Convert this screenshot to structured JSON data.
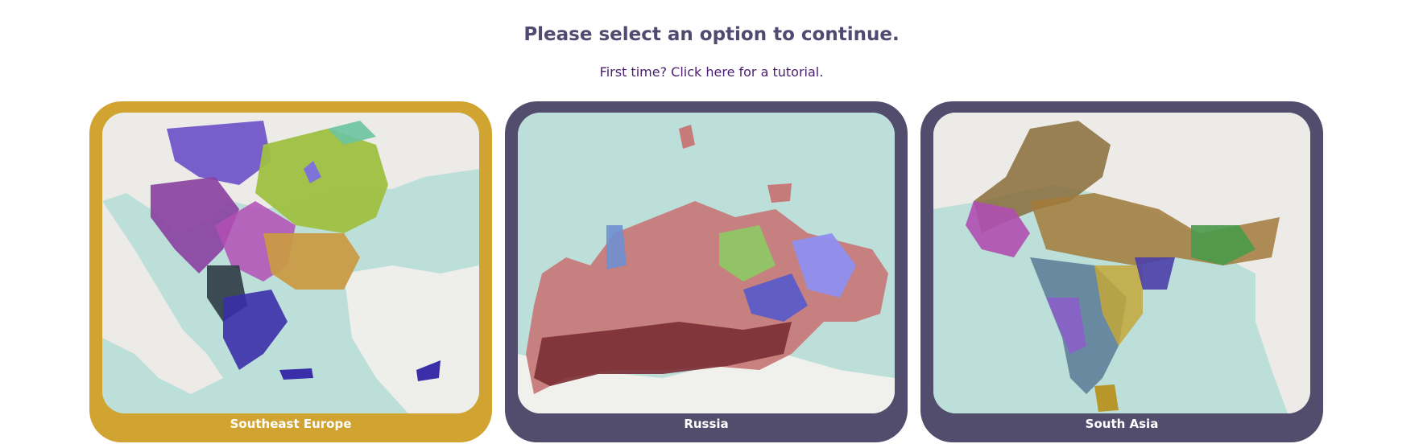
{
  "page": {
    "title": "Please select an option to continue.",
    "tutorial_link": "First time? Click here for a tutorial."
  },
  "options": [
    {
      "id": "southeast-europe",
      "label": "Southeast Europe",
      "selected": true,
      "frame_color": "#d1a431"
    },
    {
      "id": "russia",
      "label": "Russia",
      "selected": false,
      "frame_color": "#524d6d"
    },
    {
      "id": "south-asia",
      "label": "South Asia",
      "selected": false,
      "frame_color": "#524d6d"
    }
  ],
  "colors": {
    "title": "#4e4a70",
    "link": "#4a1d6e",
    "sea": "#b9dcd7",
    "land": "#f2f2f0"
  }
}
